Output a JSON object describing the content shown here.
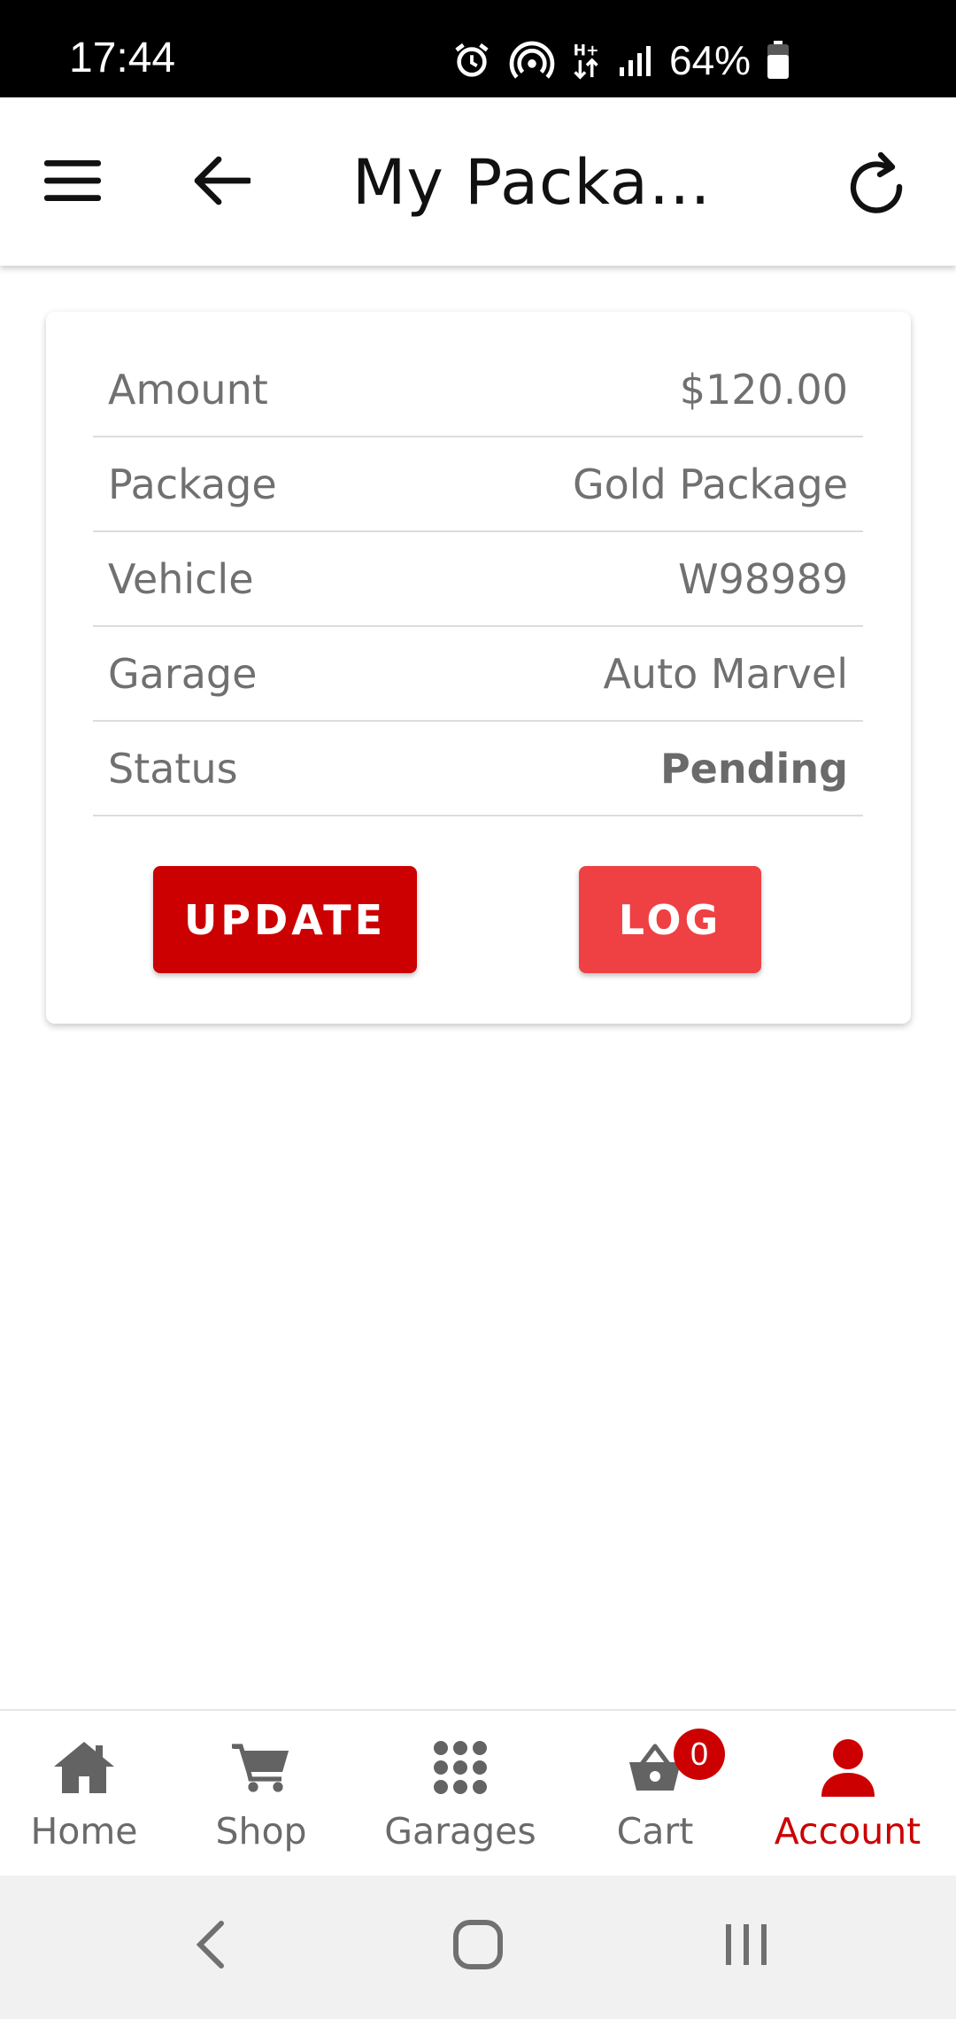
{
  "status_bar": {
    "time": "17:44",
    "battery": "64%",
    "icons": [
      "alarm-icon",
      "hotspot-icon",
      "data-icon",
      "signal-icon",
      "battery-icon"
    ]
  },
  "app_bar": {
    "title": "My Packag…",
    "menu_icon": "menu-icon",
    "back_icon": "back-arrow-icon",
    "refresh_icon": "refresh-icon"
  },
  "details": {
    "rows": [
      {
        "label": "Amount",
        "value": "$120.00"
      },
      {
        "label": "Package",
        "value": "Gold Package"
      },
      {
        "label": "Vehicle",
        "value": "W98989"
      },
      {
        "label": "Garage",
        "value": "Auto Marvel"
      },
      {
        "label": "Status",
        "value": "Pending"
      }
    ],
    "update_label": "UPDATE",
    "log_label": "LOG"
  },
  "bottom_nav": {
    "items": [
      {
        "label": "Home",
        "icon": "home-icon"
      },
      {
        "label": "Shop",
        "icon": "cart-icon"
      },
      {
        "label": "Garages",
        "icon": "grid-icon"
      },
      {
        "label": "Cart",
        "icon": "basket-icon",
        "badge": "0"
      },
      {
        "label": "Account",
        "icon": "user-icon",
        "active": true
      }
    ]
  },
  "colors": {
    "primary_red": "#cc0000",
    "light_red": "#ef4043",
    "text_gray": "#707070"
  }
}
